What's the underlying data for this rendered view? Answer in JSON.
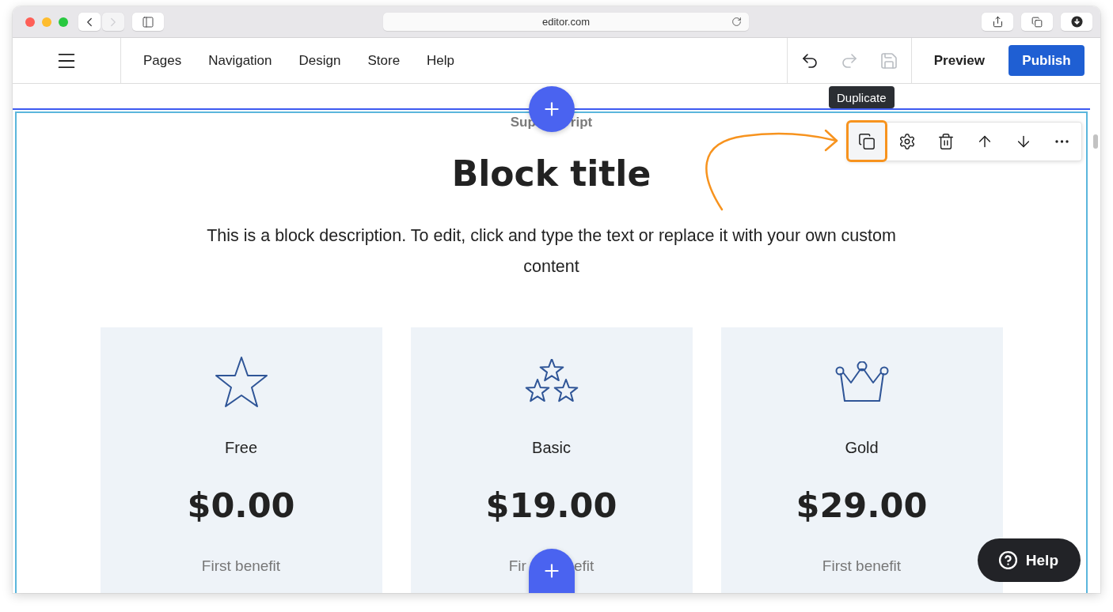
{
  "browser": {
    "nav_buttons": [
      {
        "kind": "back",
        "disabled": false
      },
      {
        "kind": "forward",
        "disabled": true
      }
    ],
    "url": "editor.com"
  },
  "app_bar": {
    "menu": [
      "Pages",
      "Navigation",
      "Design",
      "Store",
      "Help"
    ],
    "history": [
      {
        "kind": "undo",
        "disabled": false
      },
      {
        "kind": "redo",
        "disabled": true
      },
      {
        "kind": "save",
        "disabled": true
      }
    ],
    "actions": [
      {
        "label": "Preview",
        "kind": "text"
      },
      {
        "label": "Publish",
        "kind": "primary"
      }
    ]
  },
  "block_toolbar": {
    "tooltip": "Duplicate",
    "tools": [
      {
        "kind": "duplicate",
        "highlighted": true
      },
      {
        "kind": "settings",
        "highlighted": false
      },
      {
        "kind": "delete",
        "highlighted": false
      },
      {
        "kind": "move-up",
        "highlighted": false
      },
      {
        "kind": "move-down",
        "highlighted": false
      },
      {
        "kind": "more",
        "highlighted": false
      }
    ]
  },
  "block": {
    "superscript": [
      "Sup",
      "ript"
    ],
    "title": "Block title",
    "description": "This is a block description. To edit, click and type the text or replace it with your own custom content",
    "plans": [
      {
        "kind": "star",
        "name": "Free",
        "price": "$0.00",
        "benefit": [
          "First benefit"
        ]
      },
      {
        "kind": "three-stars",
        "name": "Basic",
        "price": "$19.00",
        "benefit": [
          "Fir",
          "efit"
        ]
      },
      {
        "kind": "crown",
        "name": "Gold",
        "price": "$29.00",
        "benefit": [
          "First benefit"
        ]
      }
    ]
  },
  "help_button": {
    "label": "Help"
  }
}
